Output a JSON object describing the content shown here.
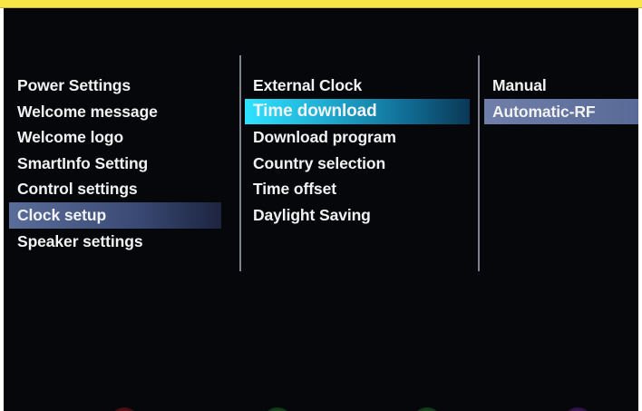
{
  "menu": {
    "col1": [
      {
        "label": "Power Settings",
        "state": "normal"
      },
      {
        "label": "Welcome message",
        "state": "normal"
      },
      {
        "label": "Welcome logo",
        "state": "normal"
      },
      {
        "label": "SmartInfo Setting",
        "state": "normal"
      },
      {
        "label": "Control settings",
        "state": "normal"
      },
      {
        "label": "Clock setup",
        "state": "path-selected"
      },
      {
        "label": "Speaker settings",
        "state": "normal"
      }
    ],
    "col2": [
      {
        "label": "External Clock",
        "state": "normal"
      },
      {
        "label": "Time download",
        "state": "active"
      },
      {
        "label": "Download program",
        "state": "normal"
      },
      {
        "label": "Country selection",
        "state": "normal"
      },
      {
        "label": "Time offset",
        "state": "normal"
      },
      {
        "label": "Daylight Saving",
        "state": "normal"
      }
    ],
    "col3": [
      {
        "label": "Manual",
        "state": "normal"
      },
      {
        "label": "Automatic-RF",
        "state": "current-value"
      }
    ]
  },
  "colors": {
    "frame_top": "#f6e646",
    "screen_bg": "#05070b",
    "active_highlight": "#2ee3ff",
    "path_highlight": "#5a6d99",
    "value_highlight": "#6f7fa9",
    "remote_dots": [
      "#d0202a",
      "#2aa83a",
      "#2aa83a",
      "#8a2ad0"
    ]
  }
}
